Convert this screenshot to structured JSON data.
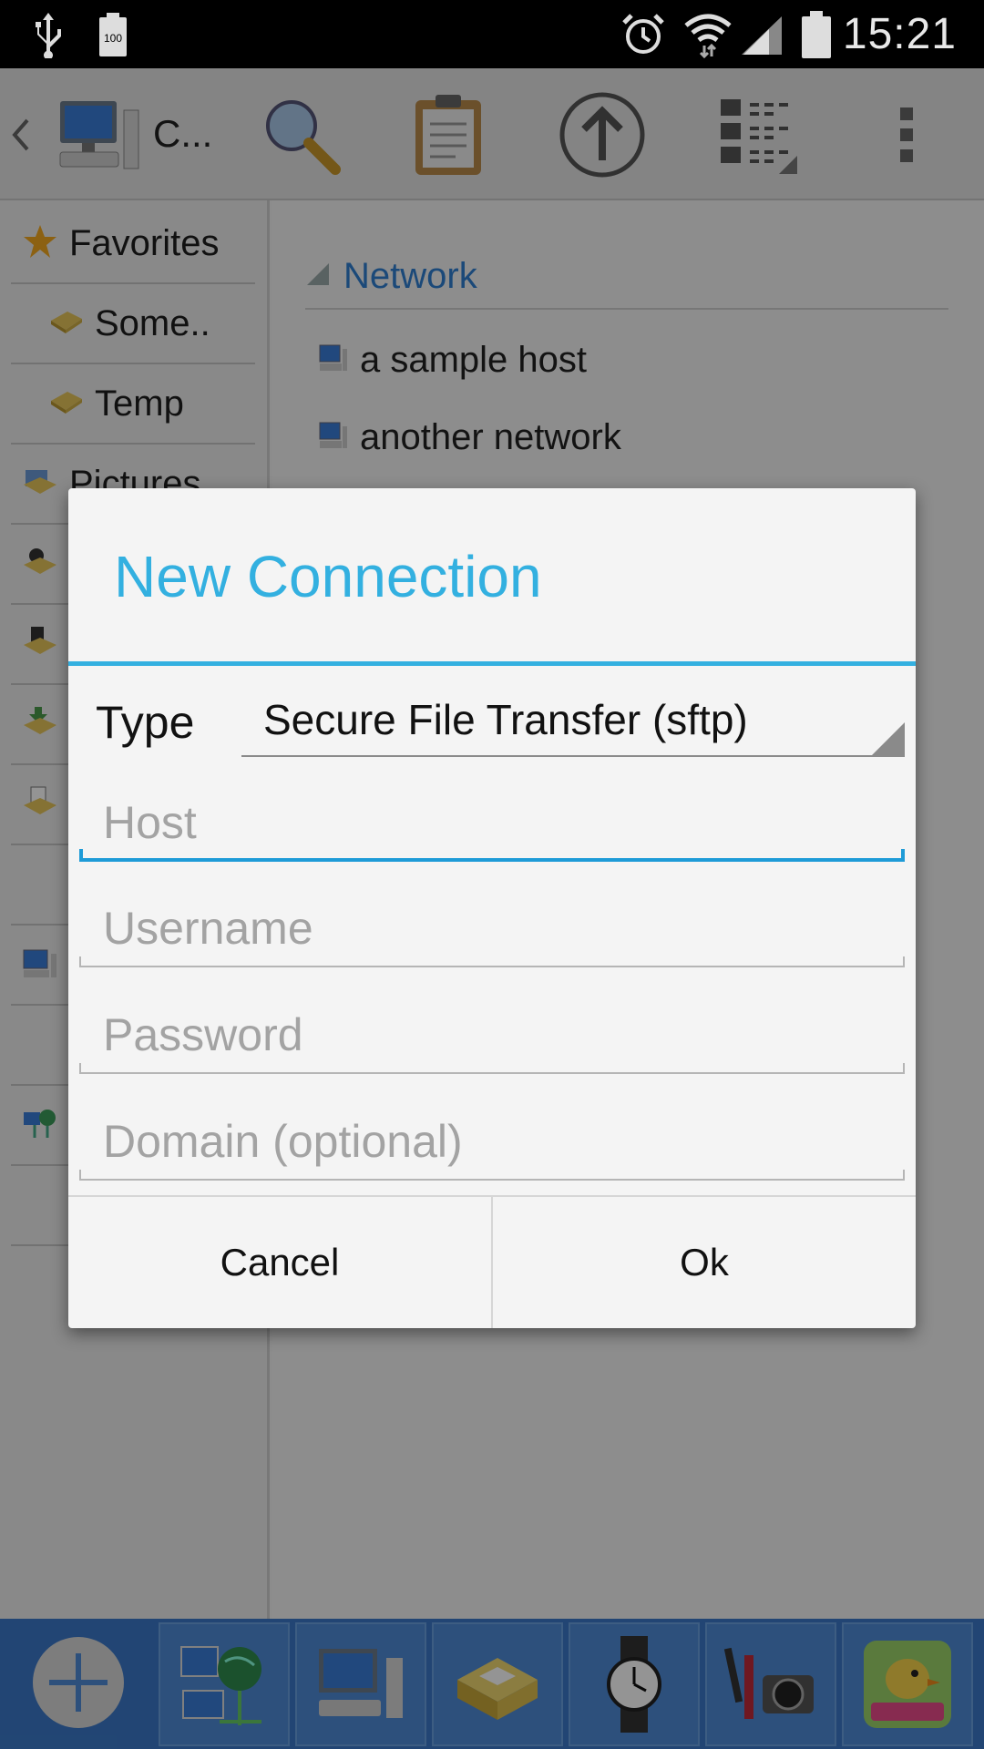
{
  "status_bar": {
    "time": "15:21",
    "battery_level_label": "100",
    "icons": [
      "usb-icon",
      "battery-saver-icon",
      "alarm-icon",
      "wifi-icon",
      "signal-icon",
      "battery-icon"
    ]
  },
  "toolbar": {
    "title": "C...",
    "icons": [
      "back-chevron-icon",
      "computer-icon",
      "search-icon",
      "clipboard-icon",
      "up-arrow-icon",
      "list-view-icon",
      "overflow-menu-icon"
    ]
  },
  "sidebar": {
    "items": [
      {
        "label": "Favorites",
        "icon": "star-icon"
      },
      {
        "label": "Some..",
        "icon": "folder-icon"
      },
      {
        "label": "Temp",
        "icon": "folder-icon"
      },
      {
        "label": "Pictures",
        "icon": "pictures-icon"
      }
    ]
  },
  "main": {
    "section_title": "Network",
    "hosts": [
      {
        "label": "a sample host",
        "icon": "computer-icon"
      },
      {
        "label": "another network",
        "icon": "computer-icon"
      }
    ]
  },
  "dialog": {
    "title": "New Connection",
    "type_label": "Type",
    "type_value": "Secure File Transfer (sftp)",
    "fields": {
      "host_placeholder": "Host",
      "username_placeholder": "Username",
      "password_placeholder": "Password",
      "domain_placeholder": "Domain (optional)"
    },
    "cancel_label": "Cancel",
    "ok_label": "Ok"
  },
  "dock": {
    "items": [
      "add-icon",
      "network-globe-icon",
      "computer-icon",
      "file-box-icon",
      "watch-icon",
      "camera-makeup-icon",
      "game-bird-icon"
    ]
  },
  "colors": {
    "accent": "#33b0e0",
    "active_field": "#1e9bd7",
    "dock": "#3b78c8",
    "link": "#2f7fd0"
  }
}
